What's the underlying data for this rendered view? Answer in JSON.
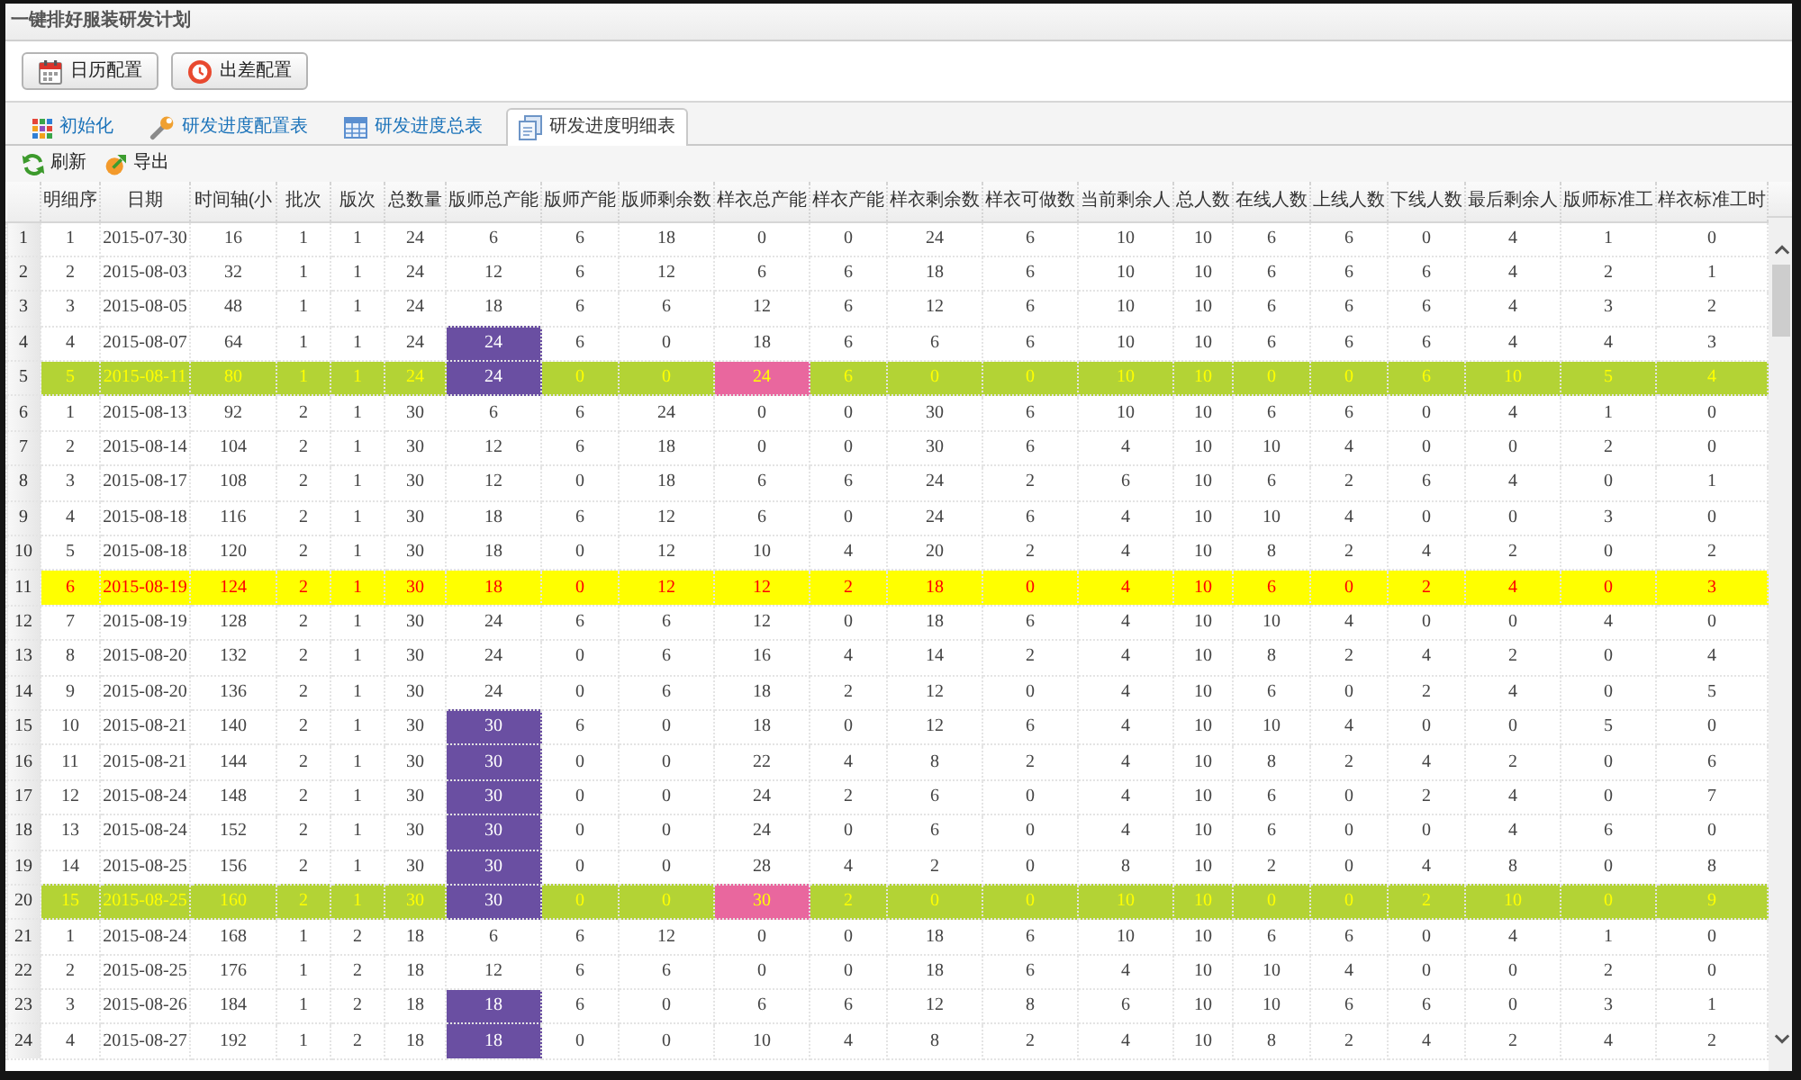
{
  "window": {
    "title": "一键排好服装研发计划"
  },
  "toolbar": {
    "buttons": [
      "日历配置",
      "出差配置"
    ]
  },
  "tabs": [
    {
      "label": "初始化",
      "selected": false
    },
    {
      "label": "研发进度配置表",
      "selected": false
    },
    {
      "label": "研发进度总表",
      "selected": false
    },
    {
      "label": "研发进度明细表",
      "selected": true
    }
  ],
  "grid_toolbar": {
    "buttons": [
      "刷新",
      "导出"
    ]
  },
  "table": {
    "columns": [
      "明细序",
      "日期",
      "时间轴(小",
      "批次",
      "版次",
      "总数量",
      "版师总产能",
      "版师产能",
      "版师剩余数",
      "样衣总产能",
      "样衣产能",
      "样衣剩余数",
      "样衣可做数",
      "当前剩余人",
      "总人数",
      "在线人数",
      "上线人数",
      "下线人数",
      "最后剩余人",
      "版师标准工",
      "样衣标准工时"
    ],
    "rows": [
      {
        "number": "1",
        "kind": "regular",
        "selected": false,
        "cells": [
          "1",
          "2015-07-30",
          "16",
          "1",
          "1",
          "24",
          "6",
          "6",
          "18",
          "0",
          "0",
          "24",
          "6",
          "10",
          "10",
          "6",
          "6",
          "0",
          "4",
          "1",
          "0"
        ]
      },
      {
        "number": "2",
        "kind": "regular",
        "selected": false,
        "cells": [
          "2",
          "2015-08-03",
          "32",
          "1",
          "1",
          "24",
          "12",
          "6",
          "12",
          "6",
          "6",
          "18",
          "6",
          "10",
          "10",
          "6",
          "6",
          "6",
          "4",
          "2",
          "1"
        ]
      },
      {
        "number": "3",
        "kind": "regular",
        "selected": false,
        "cells": [
          "3",
          "2015-08-05",
          "48",
          "1",
          "1",
          "24",
          "18",
          "6",
          "6",
          "12",
          "6",
          "12",
          "6",
          "10",
          "10",
          "6",
          "6",
          "6",
          "4",
          "3",
          "2"
        ]
      },
      {
        "number": "4",
        "kind": "regular",
        "selected": false,
        "cells": [
          "4",
          "2015-08-07",
          "64",
          "1",
          "1",
          "24",
          {
            "text": "24",
            "color": "#6a4fa2"
          },
          "6",
          "0",
          "18",
          "6",
          "6",
          "6",
          "10",
          "10",
          "6",
          "6",
          "6",
          "4",
          "4",
          "3"
        ]
      },
      {
        "number": "5",
        "kind": "batch_end",
        "selected": false,
        "cells": [
          "5",
          "2015-08-11",
          "80",
          "1",
          "1",
          "24",
          {
            "text": "24",
            "color": "#6a4fa2"
          },
          "0",
          "0",
          {
            "text": "24",
            "color": "#e9679e"
          },
          "6",
          "0",
          "0",
          "10",
          "10",
          "0",
          "0",
          "6",
          "10",
          "5",
          "4"
        ]
      },
      {
        "number": "6",
        "kind": "regular",
        "selected": false,
        "cells": [
          "1",
          "2015-08-13",
          "92",
          "2",
          "1",
          "30",
          "6",
          "6",
          "24",
          "0",
          "0",
          "30",
          "6",
          "10",
          "10",
          "6",
          "6",
          "0",
          "4",
          "1",
          "0"
        ]
      },
      {
        "number": "7",
        "kind": "regular",
        "selected": false,
        "cells": [
          "2",
          "2015-08-14",
          "104",
          "2",
          "1",
          "30",
          "12",
          "6",
          "18",
          "0",
          "0",
          "30",
          "6",
          "4",
          "10",
          "10",
          "4",
          "0",
          "0",
          "2",
          "0"
        ]
      },
      {
        "number": "8",
        "kind": "regular",
        "selected": false,
        "cells": [
          "3",
          "2015-08-17",
          "108",
          "2",
          "1",
          "30",
          "12",
          "0",
          "18",
          "6",
          "6",
          "24",
          "2",
          "6",
          "10",
          "6",
          "2",
          "6",
          "4",
          "0",
          "1"
        ]
      },
      {
        "number": "9",
        "kind": "regular",
        "selected": false,
        "cells": [
          "4",
          "2015-08-18",
          "116",
          "2",
          "1",
          "30",
          "18",
          "6",
          "12",
          "6",
          "0",
          "24",
          "6",
          "4",
          "10",
          "10",
          "4",
          "0",
          "0",
          "3",
          "0"
        ]
      },
      {
        "number": "10",
        "kind": "regular",
        "selected": false,
        "cells": [
          "5",
          "2015-08-18",
          "120",
          "2",
          "1",
          "30",
          "18",
          "0",
          "12",
          "10",
          "4",
          "20",
          "2",
          "4",
          "10",
          "8",
          "2",
          "4",
          "2",
          "0",
          "2"
        ]
      },
      {
        "number": "11",
        "kind": "regular",
        "selected": true,
        "cells": [
          "6",
          "2015-08-19",
          "124",
          "2",
          "1",
          "30",
          "18",
          "0",
          "12",
          "12",
          "2",
          "18",
          "0",
          "4",
          "10",
          "6",
          "0",
          "2",
          "4",
          "0",
          "3"
        ]
      },
      {
        "number": "12",
        "kind": "regular",
        "selected": false,
        "cells": [
          "7",
          "2015-08-19",
          "128",
          "2",
          "1",
          "30",
          "24",
          "6",
          "6",
          "12",
          "0",
          "18",
          "6",
          "4",
          "10",
          "10",
          "4",
          "0",
          "0",
          "4",
          "0"
        ]
      },
      {
        "number": "13",
        "kind": "regular",
        "selected": false,
        "cells": [
          "8",
          "2015-08-20",
          "132",
          "2",
          "1",
          "30",
          "24",
          "0",
          "6",
          "16",
          "4",
          "14",
          "2",
          "4",
          "10",
          "8",
          "2",
          "4",
          "2",
          "0",
          "4"
        ]
      },
      {
        "number": "14",
        "kind": "regular",
        "selected": false,
        "cells": [
          "9",
          "2015-08-20",
          "136",
          "2",
          "1",
          "30",
          "24",
          "0",
          "6",
          "18",
          "2",
          "12",
          "0",
          "4",
          "10",
          "6",
          "0",
          "2",
          "4",
          "0",
          "5"
        ]
      },
      {
        "number": "15",
        "kind": "regular",
        "selected": false,
        "cells": [
          "10",
          "2015-08-21",
          "140",
          "2",
          "1",
          "30",
          {
            "text": "30",
            "color": "#6a4fa2"
          },
          "6",
          "0",
          "18",
          "0",
          "12",
          "6",
          "4",
          "10",
          "10",
          "4",
          "0",
          "0",
          "5",
          "0"
        ]
      },
      {
        "number": "16",
        "kind": "regular",
        "selected": false,
        "cells": [
          "11",
          "2015-08-21",
          "144",
          "2",
          "1",
          "30",
          {
            "text": "30",
            "color": "#6a4fa2"
          },
          "0",
          "0",
          "22",
          "4",
          "8",
          "2",
          "4",
          "10",
          "8",
          "2",
          "4",
          "2",
          "0",
          "6"
        ]
      },
      {
        "number": "17",
        "kind": "regular",
        "selected": false,
        "cells": [
          "12",
          "2015-08-24",
          "148",
          "2",
          "1",
          "30",
          {
            "text": "30",
            "color": "#6a4fa2"
          },
          "0",
          "0",
          "24",
          "2",
          "6",
          "0",
          "4",
          "10",
          "6",
          "0",
          "2",
          "4",
          "0",
          "7"
        ]
      },
      {
        "number": "18",
        "kind": "regular",
        "selected": false,
        "cells": [
          "13",
          "2015-08-24",
          "152",
          "2",
          "1",
          "30",
          {
            "text": "30",
            "color": "#6a4fa2"
          },
          "0",
          "0",
          "24",
          "0",
          "6",
          "0",
          "4",
          "10",
          "6",
          "0",
          "0",
          "4",
          "6",
          "0"
        ]
      },
      {
        "number": "19",
        "kind": "regular",
        "selected": false,
        "cells": [
          "14",
          "2015-08-25",
          "156",
          "2",
          "1",
          "30",
          {
            "text": "30",
            "color": "#6a4fa2"
          },
          "0",
          "0",
          "28",
          "4",
          "2",
          "0",
          "8",
          "10",
          "2",
          "0",
          "4",
          "8",
          "0",
          "8"
        ]
      },
      {
        "number": "20",
        "kind": "batch_end",
        "selected": false,
        "cells": [
          "15",
          "2015-08-25",
          "160",
          "2",
          "1",
          "30",
          {
            "text": "30",
            "color": "#6a4fa2"
          },
          "0",
          "0",
          {
            "text": "30",
            "color": "#e9679e"
          },
          "2",
          "0",
          "0",
          "10",
          "10",
          "0",
          "0",
          "2",
          "10",
          "0",
          "9"
        ]
      },
      {
        "number": "21",
        "kind": "regular",
        "selected": false,
        "cells": [
          "1",
          "2015-08-24",
          "168",
          "1",
          "2",
          "18",
          "6",
          "6",
          "12",
          "0",
          "0",
          "18",
          "6",
          "10",
          "10",
          "6",
          "6",
          "0",
          "4",
          "1",
          "0"
        ]
      },
      {
        "number": "22",
        "kind": "regular",
        "selected": false,
        "cells": [
          "2",
          "2015-08-25",
          "176",
          "1",
          "2",
          "18",
          "12",
          "6",
          "6",
          "0",
          "0",
          "18",
          "6",
          "4",
          "10",
          "10",
          "4",
          "0",
          "0",
          "2",
          "0"
        ]
      },
      {
        "number": "23",
        "kind": "regular",
        "selected": false,
        "cells": [
          "3",
          "2015-08-26",
          "184",
          "1",
          "2",
          "18",
          {
            "text": "18",
            "color": "#6a4fa2"
          },
          "6",
          "0",
          "6",
          "6",
          "12",
          "8",
          "6",
          "10",
          "10",
          "6",
          "6",
          "0",
          "3",
          "1"
        ]
      },
      {
        "number": "24",
        "kind": "regular",
        "selected": false,
        "cells": [
          "4",
          "2015-08-27",
          "192",
          "1",
          "2",
          "18",
          {
            "text": "18",
            "color": "#6a4fa2"
          },
          "0",
          "0",
          "10",
          "4",
          "8",
          "2",
          "4",
          "10",
          "8",
          "2",
          "4",
          "2",
          "4",
          "2"
        ]
      }
    ]
  }
}
